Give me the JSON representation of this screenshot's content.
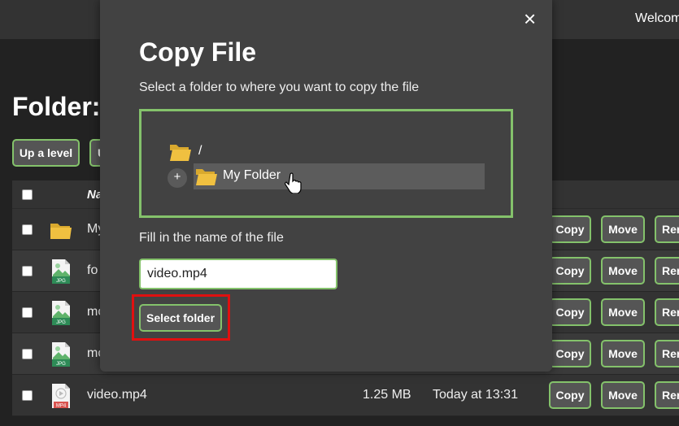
{
  "header": {
    "welcome": "Welcom"
  },
  "page": {
    "title": "Folder:"
  },
  "toolbar": {
    "up_level": "Up a level",
    "second_button": "U"
  },
  "table": {
    "name_header": "Na",
    "rows": [
      {
        "name": "My",
        "size": "",
        "date": "",
        "icon": "folder-icon"
      },
      {
        "name": "fo",
        "size": "",
        "date": "",
        "icon": "jpg-file-icon",
        "badge": "JPG"
      },
      {
        "name": "mo",
        "size": "",
        "date": "",
        "icon": "jpg-file-icon",
        "badge": "JPG"
      },
      {
        "name": "mo",
        "size": "",
        "date": "",
        "icon": "jpg-file-icon",
        "badge": "JPG"
      },
      {
        "name": "video.mp4",
        "size": "1.25 MB",
        "date": "Today at 13:31",
        "icon": "mp4-file-icon",
        "badge": "MP4"
      }
    ],
    "actions": {
      "copy": "Copy",
      "move": "Move",
      "rename": "Rer"
    }
  },
  "modal": {
    "close": "×",
    "title": "Copy File",
    "subtitle": "Select a folder to where you want to copy the file",
    "tree": {
      "root": "/",
      "expand": "+",
      "item": "My Folder"
    },
    "fill_label": "Fill in the name of the file",
    "file_name_value": "video.mp4",
    "select_folder": "Select folder"
  },
  "colors": {
    "accent": "#84c26b",
    "highlight": "#e01010",
    "folder": "#f0c040",
    "jpg_badge": "#2e8b57",
    "mp4_badge": "#d9534f"
  }
}
